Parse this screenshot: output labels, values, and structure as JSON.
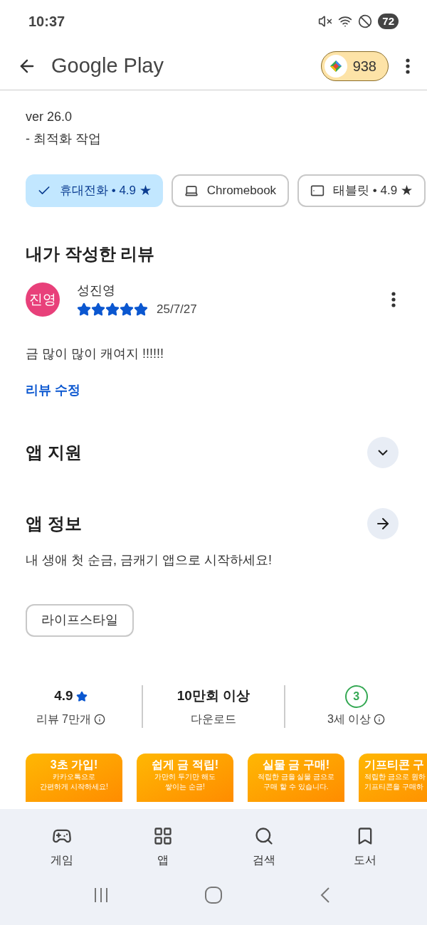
{
  "status_bar": {
    "time": "10:37",
    "battery": "72"
  },
  "app_bar": {
    "title": "Google Play",
    "points": "938"
  },
  "whats_new": {
    "version": "ver 26.0",
    "notes": "- 최적화 작업"
  },
  "device_chips": [
    {
      "kind": "phone",
      "label": "휴대전화 • 4.9 ★",
      "selected": true
    },
    {
      "kind": "laptop",
      "label": "Chromebook",
      "selected": false
    },
    {
      "kind": "tablet",
      "label": "태블릿 • 4.9 ★",
      "selected": false
    }
  ],
  "my_review": {
    "heading": "내가 작성한 리뷰",
    "avatar": "진영",
    "name": "성진영",
    "stars": 5,
    "date": "25/7/27",
    "text": "금 많이 많이 캐여지 !!!!!!",
    "edit_link": "리뷰 수정"
  },
  "sections": [
    {
      "kind": "expand",
      "title": "앱 지원"
    },
    {
      "kind": "arrow",
      "title": "앱 정보"
    }
  ],
  "description": "내 생애 첫 순금, 금캐기 앱으로 시작하세요!",
  "category_tag": "라이프스타일",
  "stats": [
    {
      "kind": "rating",
      "value": "4.9",
      "label": "리뷰 7만개"
    },
    {
      "kind": "plain",
      "value": "10만회 이상",
      "label": "다운로드"
    },
    {
      "kind": "age",
      "value": "3",
      "label": "3세 이상"
    }
  ],
  "screenshots": [
    {
      "title": "3초 가입!",
      "lines": [
        "카카오톡으로",
        "간편하게 시작하세요!"
      ]
    },
    {
      "title": "쉽게 금 적립!",
      "lines": [
        "가만히 두기만 해도",
        "쌓이는 순금!"
      ]
    },
    {
      "title": "실물 금 구매!",
      "lines": [
        "적립한 금을 실물 금으로",
        "구매 할 수 있습니다."
      ]
    },
    {
      "title": "기프티콘 구",
      "lines": [
        "적립한 금으로 원하",
        "기프티콘을 구매하"
      ]
    }
  ],
  "bottom_nav": [
    {
      "kind": "games",
      "label": "게임"
    },
    {
      "kind": "apps",
      "label": "앱"
    },
    {
      "kind": "search",
      "label": "검색"
    },
    {
      "kind": "books",
      "label": "도서"
    }
  ]
}
